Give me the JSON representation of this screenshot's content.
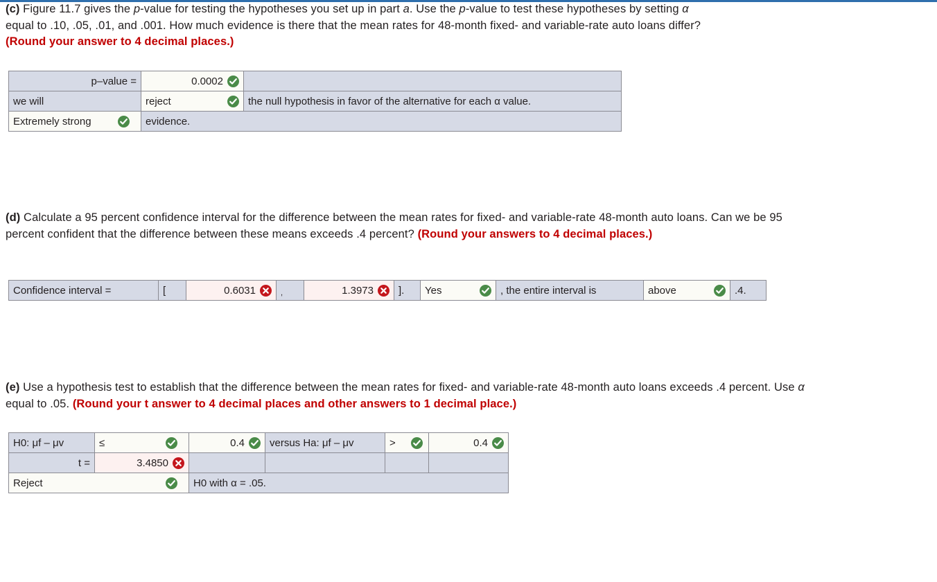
{
  "theme": {
    "accent_blue": "#2f6fad",
    "label_cell_bg": "#d6dae6",
    "answer_cell_bg": "#fbfbf6",
    "wrong_cell_bg": "#fdf1f0",
    "correct_green": "#4a8b48",
    "incorrect_red": "#c4161c",
    "instruction_red": "#c00000"
  },
  "questions": {
    "c": {
      "label": "(c)",
      "text_line1_a": " Figure 11.7 gives the ",
      "text_p1": "p",
      "text_line1_b": "-value for testing the hypotheses you set up in part ",
      "text_a": "a",
      "text_line1_c": ". Use the ",
      "text_p2": "p",
      "text_line1_d": "-value to test these hypotheses by setting ",
      "text_alpha": "α",
      "text_line2": "equal to .10, .05, .01, and .001. How much evidence is there that the mean rates for 48-month fixed- and variable-rate auto loans differ?",
      "instruction": "(Round your answer to 4 decimal places.)"
    },
    "d": {
      "label": "(d)",
      "text": " Calculate a 95 percent confidence interval for the difference between the mean rates for fixed- and variable-rate 48-month auto loans. Can we be 95 percent confident that the difference between these means exceeds .4 percent? ",
      "instruction": "(Round your answers to 4 decimal places.)"
    },
    "e": {
      "label": "(e)",
      "text_a": " Use a hypothesis test to establish that the difference between the mean rates for fixed- and variable-rate 48-month auto loans exceeds .4 percent. Use ",
      "text_alpha": "α",
      "text_b": " equal to .05. ",
      "instruction": "(Round your t answer to 4 decimal places and other answers to 1 decimal place.)"
    }
  },
  "table_c": {
    "row1": {
      "label": "p–value =",
      "value": "0.0002",
      "status": "correct",
      "trailing": ""
    },
    "row2": {
      "label": "we will",
      "value": "reject",
      "status": "correct",
      "trailing": "the null hypothesis in favor of the alternative for each α value."
    },
    "row3": {
      "label": "Extremely strong",
      "status": "correct",
      "trailing": "evidence."
    }
  },
  "table_d": {
    "label": "Confidence interval =",
    "bracket_open": "[",
    "lower": "0.6031",
    "lower_status": "incorrect",
    "comma": ",",
    "upper": "1.3973",
    "upper_status": "incorrect",
    "bracket_close": "].",
    "answer_yesno": "Yes",
    "yesno_status": "correct",
    "mid_text": ", the entire interval is",
    "direction": "above",
    "direction_status": "correct",
    "tail_text": ".4."
  },
  "table_e": {
    "row1": {
      "h0_label": "H0: μf – μv",
      "operator": "≤",
      "operator_status": "correct",
      "value": "0.4",
      "value_status": "correct",
      "ha_label": "versus Ha: μf – μv",
      "ha_operator": ">",
      "ha_operator_status": "correct",
      "ha_value": "0.4",
      "ha_value_status": "correct"
    },
    "row2": {
      "label": "t =",
      "value": "3.4850",
      "status": "incorrect"
    },
    "row3": {
      "decision": "Reject",
      "decision_status": "correct",
      "trailing": "H0 with α  = .05."
    }
  },
  "icons": {
    "correct": "check-circle-icon",
    "incorrect": "x-circle-icon"
  }
}
